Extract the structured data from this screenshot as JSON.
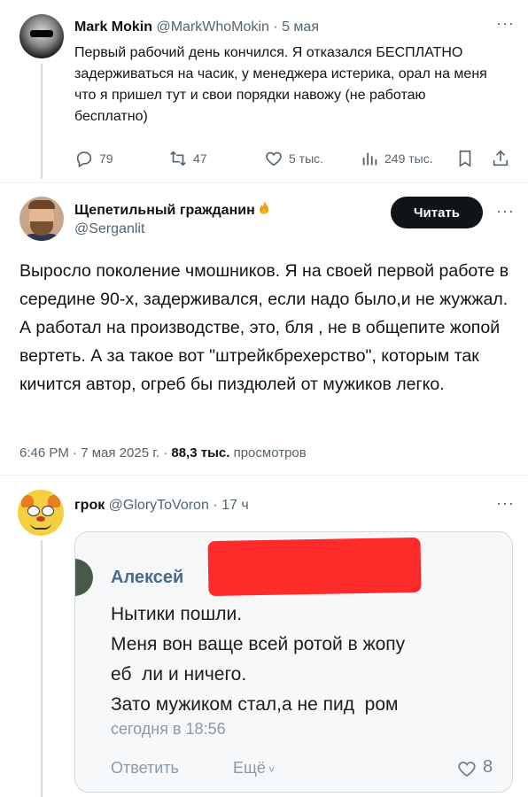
{
  "tweet1": {
    "name": "Mark Mokin",
    "handle": "@MarkWhoMokin",
    "time": "5 мая",
    "text": "Первый рабочий день кончился. Я отказался БЕСПЛАТНО задерживаться на часик, у менеджера истерика, орал на меня что я пришел тут и свои порядки навожу (не работаю бесплатно)",
    "replies": "79",
    "reposts": "47",
    "likes": "5 тыс.",
    "views": "249 тыс."
  },
  "tweet2": {
    "name": "Щепетильный гражданин",
    "handle": "@Serganlit",
    "follow_label": "Читать",
    "text": "Выросло поколение чмошников. Я на своей первой работе в середине 90-х, задерживался, если надо было,и не жужжал. А работал на производстве, это, бля , не в общепите жопой вертеть. А за такое вот \"штрейкбрехерство\", которым так кичится автор, огреб бы пиздюлей от мужиков легко.",
    "time": "6:46 PM",
    "date": "7 мая 2025 г.",
    "views": "88,3 тыс.",
    "views_label": "просмотров"
  },
  "tweet3": {
    "name": "грок",
    "handle": "@GloryToVoron",
    "time": "17 ч",
    "photo": {
      "author": "Алексей",
      "lines": [
        "Нытики пошли.",
        "Меня вон ваще всей ротой в жопу",
        "еб  ли и ничего.",
        "Зато мужиком стал,а не пид  ром"
      ],
      "timestamp": "сегодня в 18:56",
      "reply_label": "Ответить",
      "more_label": "Ещё",
      "likes": "8"
    }
  },
  "colors": {
    "text": "#0f1419",
    "secondary": "#536471",
    "redaction": "#ff2a2a",
    "button": "#0f1419"
  },
  "icons": [
    "reply-icon",
    "repost-icon",
    "like-icon",
    "views-icon",
    "bookmark-icon",
    "share-icon",
    "more-icon",
    "fire-icon"
  ]
}
